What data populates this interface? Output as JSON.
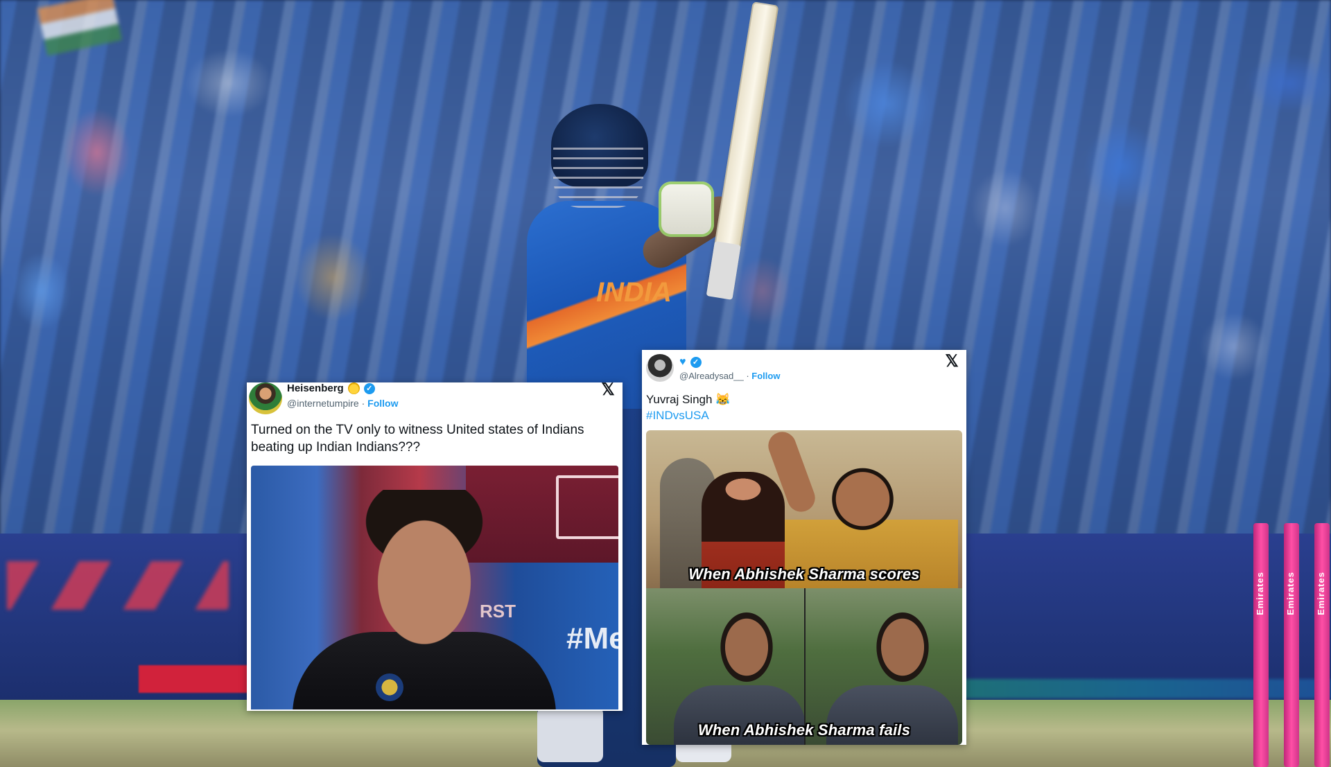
{
  "background": {
    "team_text": "INDIA",
    "stump_brand": "Emirates"
  },
  "tweet_a": {
    "display_name": "Heisenberg",
    "handle": "@internetumpire",
    "separator": "·",
    "follow": "Follow",
    "close_icon": "x-logo-icon",
    "text": "Turned on the TV only to witness United states of Indians beating up Indian Indians???",
    "media": {
      "jersey_text": "#Men",
      "board_text": "RST"
    }
  },
  "tweet_b": {
    "handle": "@Alreadysad__",
    "separator": "·",
    "follow": "Follow",
    "close_icon": "x-logo-icon",
    "text_line1": "Yuvraj Singh 😹",
    "hashtag": "#INDvsUSA",
    "media": {
      "caption_top": "When Abhishek Sharma scores",
      "caption_bottom": "When Abhishek Sharma fails"
    }
  },
  "colors": {
    "link_blue": "#1d9bf0",
    "stump_pink": "#ff4fa6"
  }
}
